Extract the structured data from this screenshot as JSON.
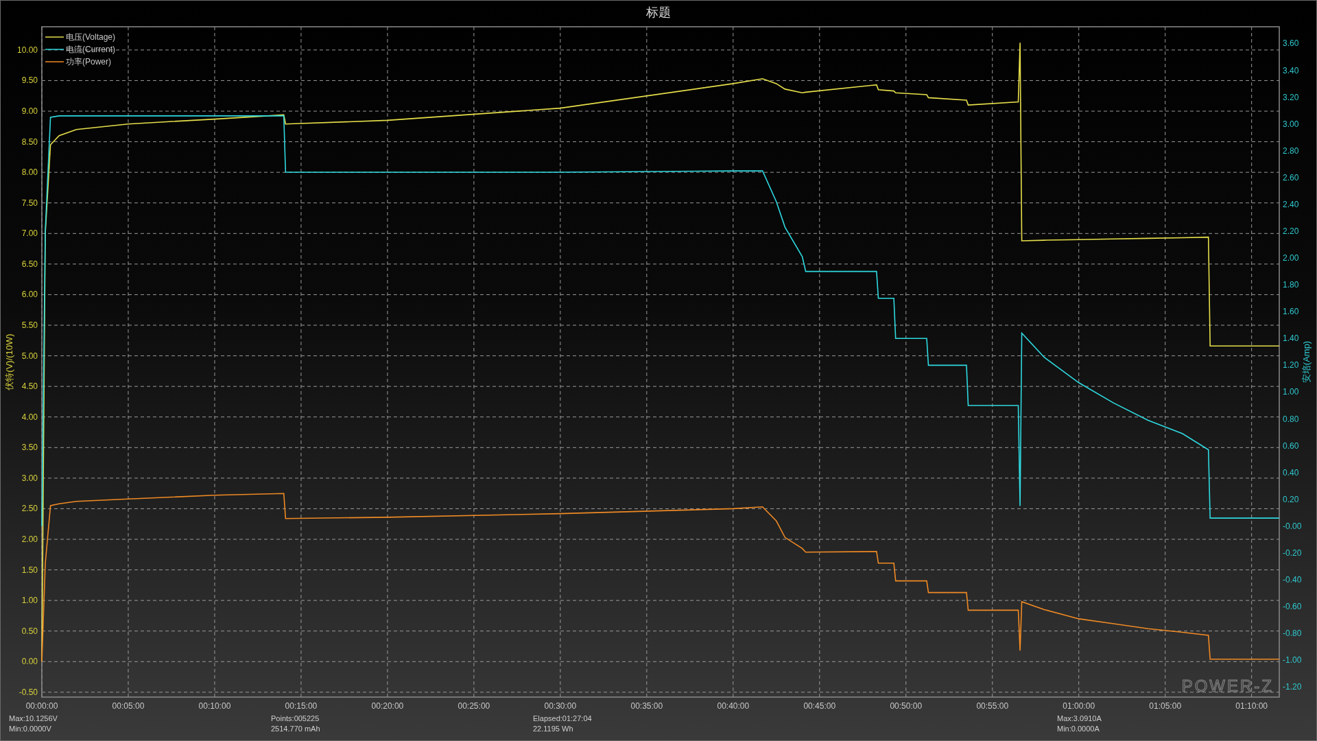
{
  "chart_data": {
    "type": "line",
    "title": "标题",
    "ylabel": "伏特(V)/(10W)",
    "y2label": "安培(Amp)",
    "grid": true,
    "legend": true,
    "x": [
      0,
      0.2,
      0.5,
      1,
      2,
      5,
      10,
      14,
      14.1,
      20,
      30,
      40,
      41.7,
      42.5,
      43,
      44,
      44.2,
      48.3,
      48.4,
      49.3,
      49.4,
      51.2,
      51.3,
      53.5,
      53.6,
      56.5,
      56.6,
      56.7,
      58,
      60,
      62,
      64,
      66,
      67.5,
      67.6,
      71.6
    ],
    "series": [
      {
        "name": "电压(Voltage)",
        "color": "#e6df4a",
        "values": [
          0,
          7.0,
          8.45,
          8.6,
          8.7,
          8.79,
          8.87,
          8.94,
          8.79,
          8.85,
          9.05,
          9.45,
          9.53,
          9.45,
          9.36,
          9.3,
          9.31,
          9.43,
          9.35,
          9.33,
          9.3,
          9.27,
          9.22,
          9.18,
          9.1,
          9.15,
          10.12,
          6.88,
          6.89,
          6.9,
          6.91,
          6.92,
          6.93,
          6.94,
          5.16,
          5.16
        ]
      },
      {
        "name": "电流(Current)",
        "color": "#2fd9e0",
        "axis": "y2",
        "values": [
          0,
          2.2,
          3.05,
          3.06,
          3.06,
          3.06,
          3.06,
          3.06,
          2.64,
          2.64,
          2.64,
          2.65,
          2.65,
          2.42,
          2.23,
          2.01,
          1.9,
          1.9,
          1.7,
          1.7,
          1.4,
          1.4,
          1.2,
          1.2,
          0.9,
          0.9,
          0.15,
          1.44,
          1.26,
          1.07,
          0.92,
          0.79,
          0.69,
          0.57,
          0.06,
          0.06
        ]
      },
      {
        "name": "功率(Power)",
        "color": "#f08a24",
        "values": [
          0,
          1.6,
          2.55,
          2.58,
          2.62,
          2.66,
          2.72,
          2.75,
          2.34,
          2.36,
          2.42,
          2.5,
          2.53,
          2.3,
          2.03,
          1.85,
          1.79,
          1.8,
          1.61,
          1.61,
          1.32,
          1.32,
          1.13,
          1.13,
          0.84,
          0.84,
          0.18,
          0.98,
          0.85,
          0.7,
          0.62,
          0.54,
          0.48,
          0.43,
          0.04,
          0.04
        ]
      }
    ],
    "xlim": [
      0,
      71.6
    ],
    "ylim": [
      -0.58,
      10.38
    ],
    "y2lim": [
      -1.275,
      3.725
    ],
    "xticks": [
      {
        "value": 0,
        "label": "00:00:00"
      },
      {
        "value": 5,
        "label": "00:05:00"
      },
      {
        "value": 10,
        "label": "00:10:00"
      },
      {
        "value": 15,
        "label": "00:15:00"
      },
      {
        "value": 20,
        "label": "00:20:00"
      },
      {
        "value": 25,
        "label": "00:25:00"
      },
      {
        "value": 30,
        "label": "00:30:00"
      },
      {
        "value": 35,
        "label": "00:35:00"
      },
      {
        "value": 40,
        "label": "00:40:00"
      },
      {
        "value": 45,
        "label": "00:45:00"
      },
      {
        "value": 50,
        "label": "00:50:00"
      },
      {
        "value": 55,
        "label": "00:55:00"
      },
      {
        "value": 60,
        "label": "01:00:00"
      },
      {
        "value": 65,
        "label": "01:05:00"
      },
      {
        "value": 70,
        "label": "01:10:00"
      }
    ],
    "yticks": [
      {
        "value": -0.5,
        "label": "-0.50"
      },
      {
        "value": 0,
        "label": "0.00"
      },
      {
        "value": 0.5,
        "label": "0.50"
      },
      {
        "value": 1,
        "label": "1.00"
      },
      {
        "value": 1.5,
        "label": "1.50"
      },
      {
        "value": 2,
        "label": "2.00"
      },
      {
        "value": 2.5,
        "label": "2.50"
      },
      {
        "value": 3,
        "label": "3.00"
      },
      {
        "value": 3.5,
        "label": "3.50"
      },
      {
        "value": 4,
        "label": "4.00"
      },
      {
        "value": 4.5,
        "label": "4.50"
      },
      {
        "value": 5,
        "label": "5.00"
      },
      {
        "value": 5.5,
        "label": "5.50"
      },
      {
        "value": 6,
        "label": "6.00"
      },
      {
        "value": 6.5,
        "label": "6.50"
      },
      {
        "value": 7,
        "label": "7.00"
      },
      {
        "value": 7.5,
        "label": "7.50"
      },
      {
        "value": 8,
        "label": "8.00"
      },
      {
        "value": 8.5,
        "label": "8.50"
      },
      {
        "value": 9,
        "label": "9.00"
      },
      {
        "value": 9.5,
        "label": "9.50"
      },
      {
        "value": 10,
        "label": "10.00"
      }
    ],
    "y2ticks": [
      {
        "value": -1.2,
        "label": "-1.20"
      },
      {
        "value": -1,
        "label": "-1.00"
      },
      {
        "value": -0.8,
        "label": "-0.80"
      },
      {
        "value": -0.6,
        "label": "-0.60"
      },
      {
        "value": -0.4,
        "label": "-0.40"
      },
      {
        "value": -0.2,
        "label": "-0.20"
      },
      {
        "value": 0,
        "label": "-0.00"
      },
      {
        "value": 0.2,
        "label": "0.20"
      },
      {
        "value": 0.4,
        "label": "0.40"
      },
      {
        "value": 0.6,
        "label": "0.60"
      },
      {
        "value": 0.8,
        "label": "0.80"
      },
      {
        "value": 1,
        "label": "1.00"
      },
      {
        "value": 1.2,
        "label": "1.20"
      },
      {
        "value": 1.4,
        "label": "1.40"
      },
      {
        "value": 1.6,
        "label": "1.60"
      },
      {
        "value": 1.8,
        "label": "1.80"
      },
      {
        "value": 2,
        "label": "2.00"
      },
      {
        "value": 2.2,
        "label": "2.20"
      },
      {
        "value": 2.4,
        "label": "2.40"
      },
      {
        "value": 2.6,
        "label": "2.60"
      },
      {
        "value": 2.8,
        "label": "2.80"
      },
      {
        "value": 3,
        "label": "3.00"
      },
      {
        "value": 3.2,
        "label": "3.20"
      },
      {
        "value": 3.4,
        "label": "3.40"
      },
      {
        "value": 3.6,
        "label": "3.60"
      }
    ]
  },
  "brand": "POWER-Z",
  "stats": [
    {
      "top": "Max:10.1256V",
      "bottom": "Min:0.0000V"
    },
    {
      "top": "Points:005225",
      "bottom": "2514.770 mAh"
    },
    {
      "top": "Elapsed:01:27:04",
      "bottom": "22.1195 Wh"
    },
    {
      "top": "Max:3.0910A",
      "bottom": "Min:0.0000A"
    }
  ]
}
